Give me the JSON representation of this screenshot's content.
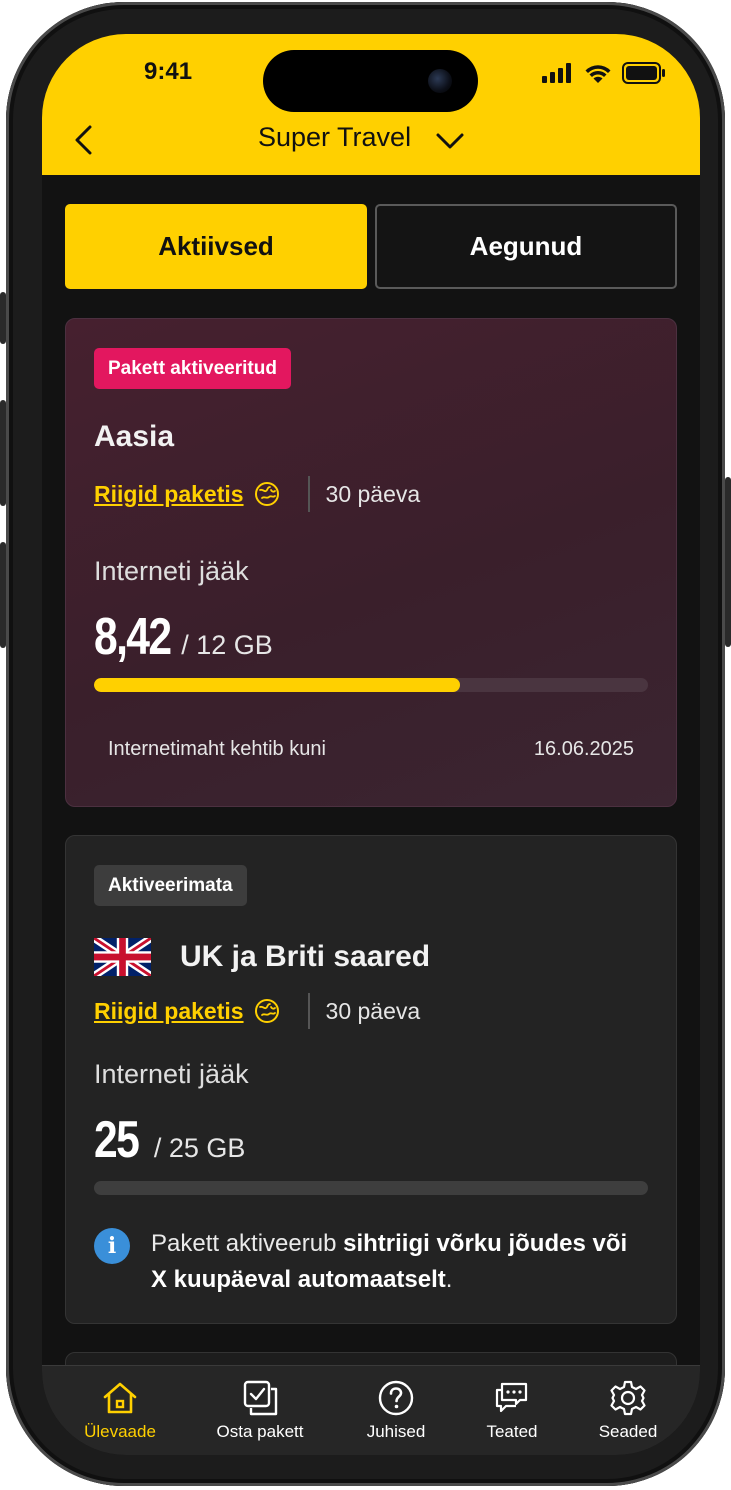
{
  "status_bar": {
    "time": "9:41"
  },
  "header": {
    "title": "Super Travel"
  },
  "tabs": [
    {
      "label": "Aktiivsed",
      "active": true
    },
    {
      "label": "Aegunud",
      "active": false
    }
  ],
  "packages": [
    {
      "badge": "Pakett aktiveeritud",
      "name": "Aasia",
      "countries_link": "Riigid paketis",
      "duration": "30 päeva",
      "data_label": "Interneti jääk",
      "remaining": "8,42",
      "total": "/ 12 GB",
      "remaining_fraction": 0.66,
      "valid_label": "Internetimaht kehtib kuni",
      "valid_date": "16.06.2025"
    },
    {
      "badge": "Aktiveerimata",
      "name": "UK ja Briti saared",
      "flag_icon": "uk-flag-icon",
      "countries_link": "Riigid paketis",
      "duration": "30 päeva",
      "data_label": "Interneti jääk",
      "remaining": "25",
      "total": "/ 25 GB",
      "remaining_fraction": 0.0,
      "info_text_1": "Pakett aktiveerub ",
      "info_text_bold_1": "sihtriigi võrku jõudes või X kuupäeval automaatselt",
      "info_text_2": "."
    }
  ],
  "bottom_nav": [
    {
      "label": "Ülevaade",
      "icon": "home-icon",
      "active": true
    },
    {
      "label": "Osta pakett",
      "icon": "buy-package-icon",
      "active": false
    },
    {
      "label": "Juhised",
      "icon": "help-icon",
      "active": false
    },
    {
      "label": "Teated",
      "icon": "messages-icon",
      "active": false
    },
    {
      "label": "Seaded",
      "icon": "settings-icon",
      "active": false
    }
  ],
  "colors": {
    "accent": "#FFD000",
    "badge_active": "#E3175F",
    "info": "#3a8fd9"
  }
}
